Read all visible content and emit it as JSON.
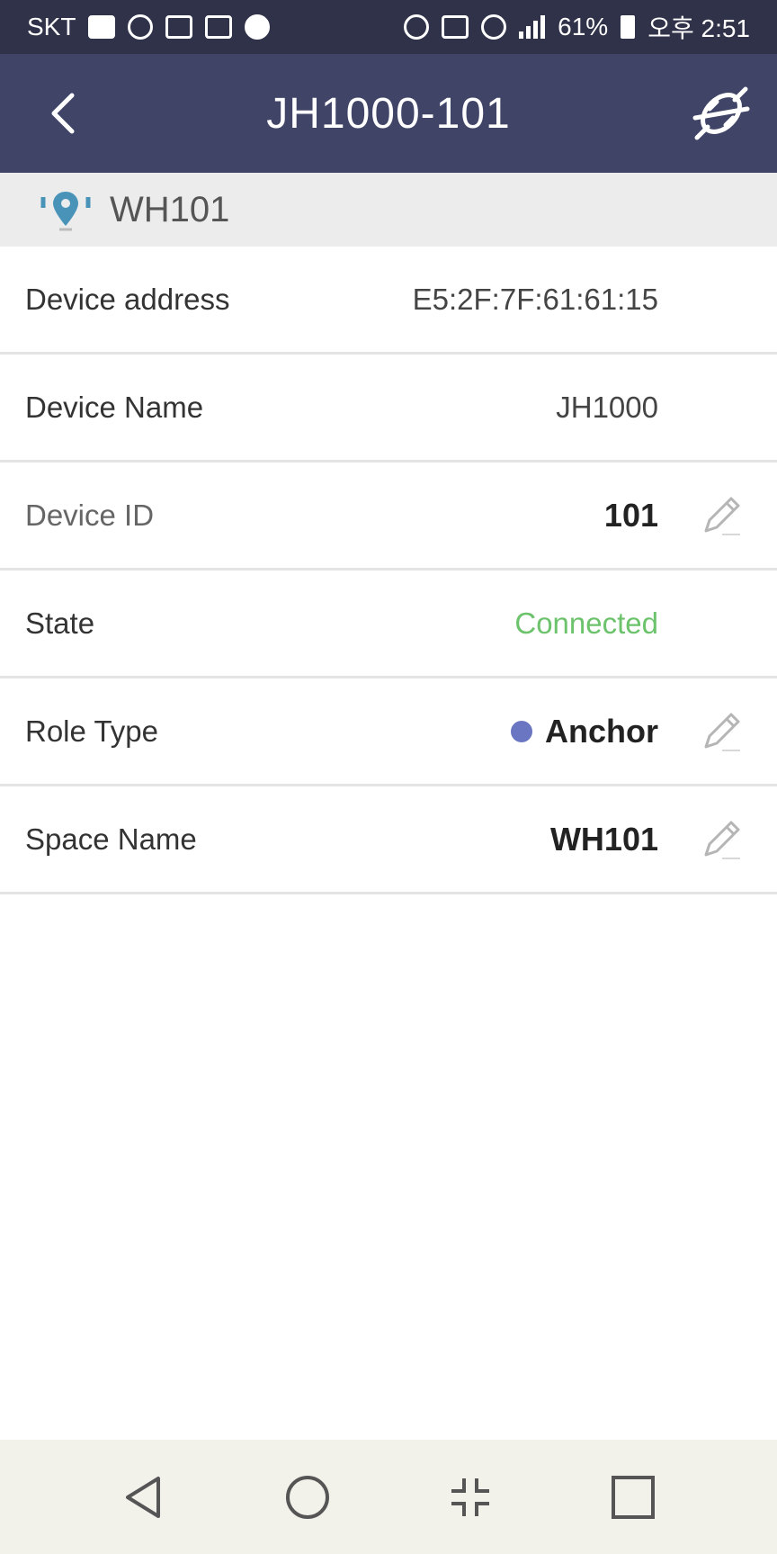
{
  "status_bar": {
    "carrier": "SKT",
    "battery": "61%",
    "time": "오후 2:51",
    "left_icons": [
      "message-icon",
      "chat-icon",
      "a-app-icon",
      "gallery-icon",
      "w-app-icon"
    ],
    "right_icons": [
      "bluetooth-icon",
      "nfc-icon",
      "wifi-icon",
      "signal-icon",
      "battery-icon"
    ]
  },
  "app_bar": {
    "title": "JH1000-101",
    "back_icon": "chevron-left-icon",
    "action_icon": "plug-disconnect-icon"
  },
  "space_header": {
    "icon": "location-pin-icon",
    "label": "WH101"
  },
  "rows": [
    {
      "label": "Device address",
      "value": "E5:2F:7F:61:61:15",
      "editable": false
    },
    {
      "label": "Device Name",
      "value": "JH1000",
      "editable": false
    },
    {
      "label": "Device ID",
      "value": "101",
      "editable": true
    },
    {
      "label": "State",
      "value": "Connected",
      "editable": false
    },
    {
      "label": "Role Type",
      "value": "Anchor",
      "editable": true
    },
    {
      "label": "Space Name",
      "value": "WH101",
      "editable": true
    }
  ],
  "colors": {
    "status_bar": "#2f3248",
    "app_bar": "#404467",
    "connected": "#6cc36c",
    "anchor_dot": "#6a76c2",
    "nav_bar": "#f3f2ea"
  },
  "nav_bar": {
    "buttons": [
      "back-triangle-icon",
      "home-circle-icon",
      "split-screen-icon",
      "recents-square-icon"
    ]
  }
}
